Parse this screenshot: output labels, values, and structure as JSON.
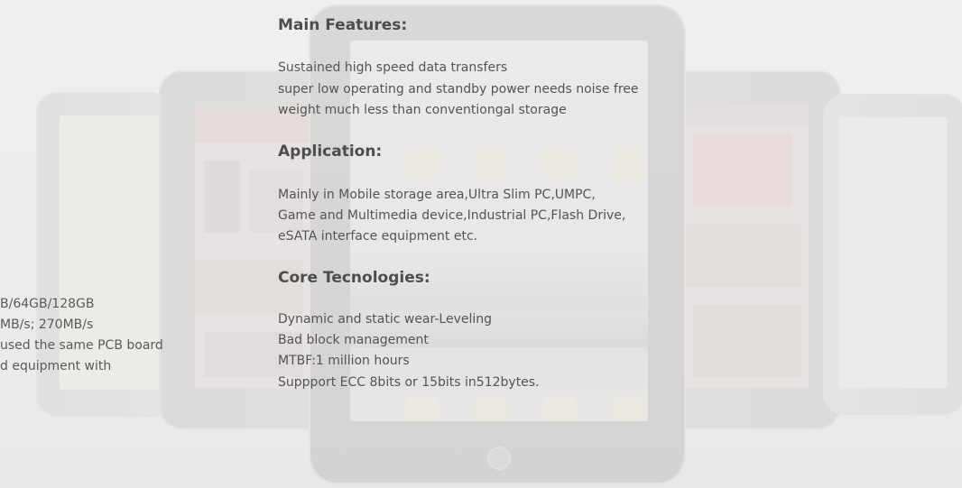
{
  "sections": [
    {
      "heading": "Main Features:",
      "lines": [
        "Sustained high speed data transfers",
        "super low operating and standby power needs noise free",
        "weight much less than conventiongal storage"
      ]
    },
    {
      "heading": "Application:",
      "lines": [
        "Mainly in Mobile storage area,Ultra Slim PC,UMPC,",
        "Game and Multimedia device,Industrial PC,Flash Drive,",
        "eSATA interface equipment etc."
      ]
    },
    {
      "heading": "Core Tecnologies:",
      "lines": [
        "Dynamic and static wear-Leveling",
        "Bad block management",
        "MTBF:1 million hours",
        "Suppport ECC 8bits or 15bits  in512bytes."
      ]
    }
  ],
  "left_spec_lines": [
    "B/64GB/128GB",
    "MB/s; 270MB/s",
    "used the same PCB board",
    "d  equipment with"
  ],
  "colors": {
    "background": "#ececec",
    "heading": "#4d4d4d",
    "body_text": "#545454"
  },
  "icons": [
    "tablet-device-image",
    "home-button-icon",
    "app-icon"
  ]
}
